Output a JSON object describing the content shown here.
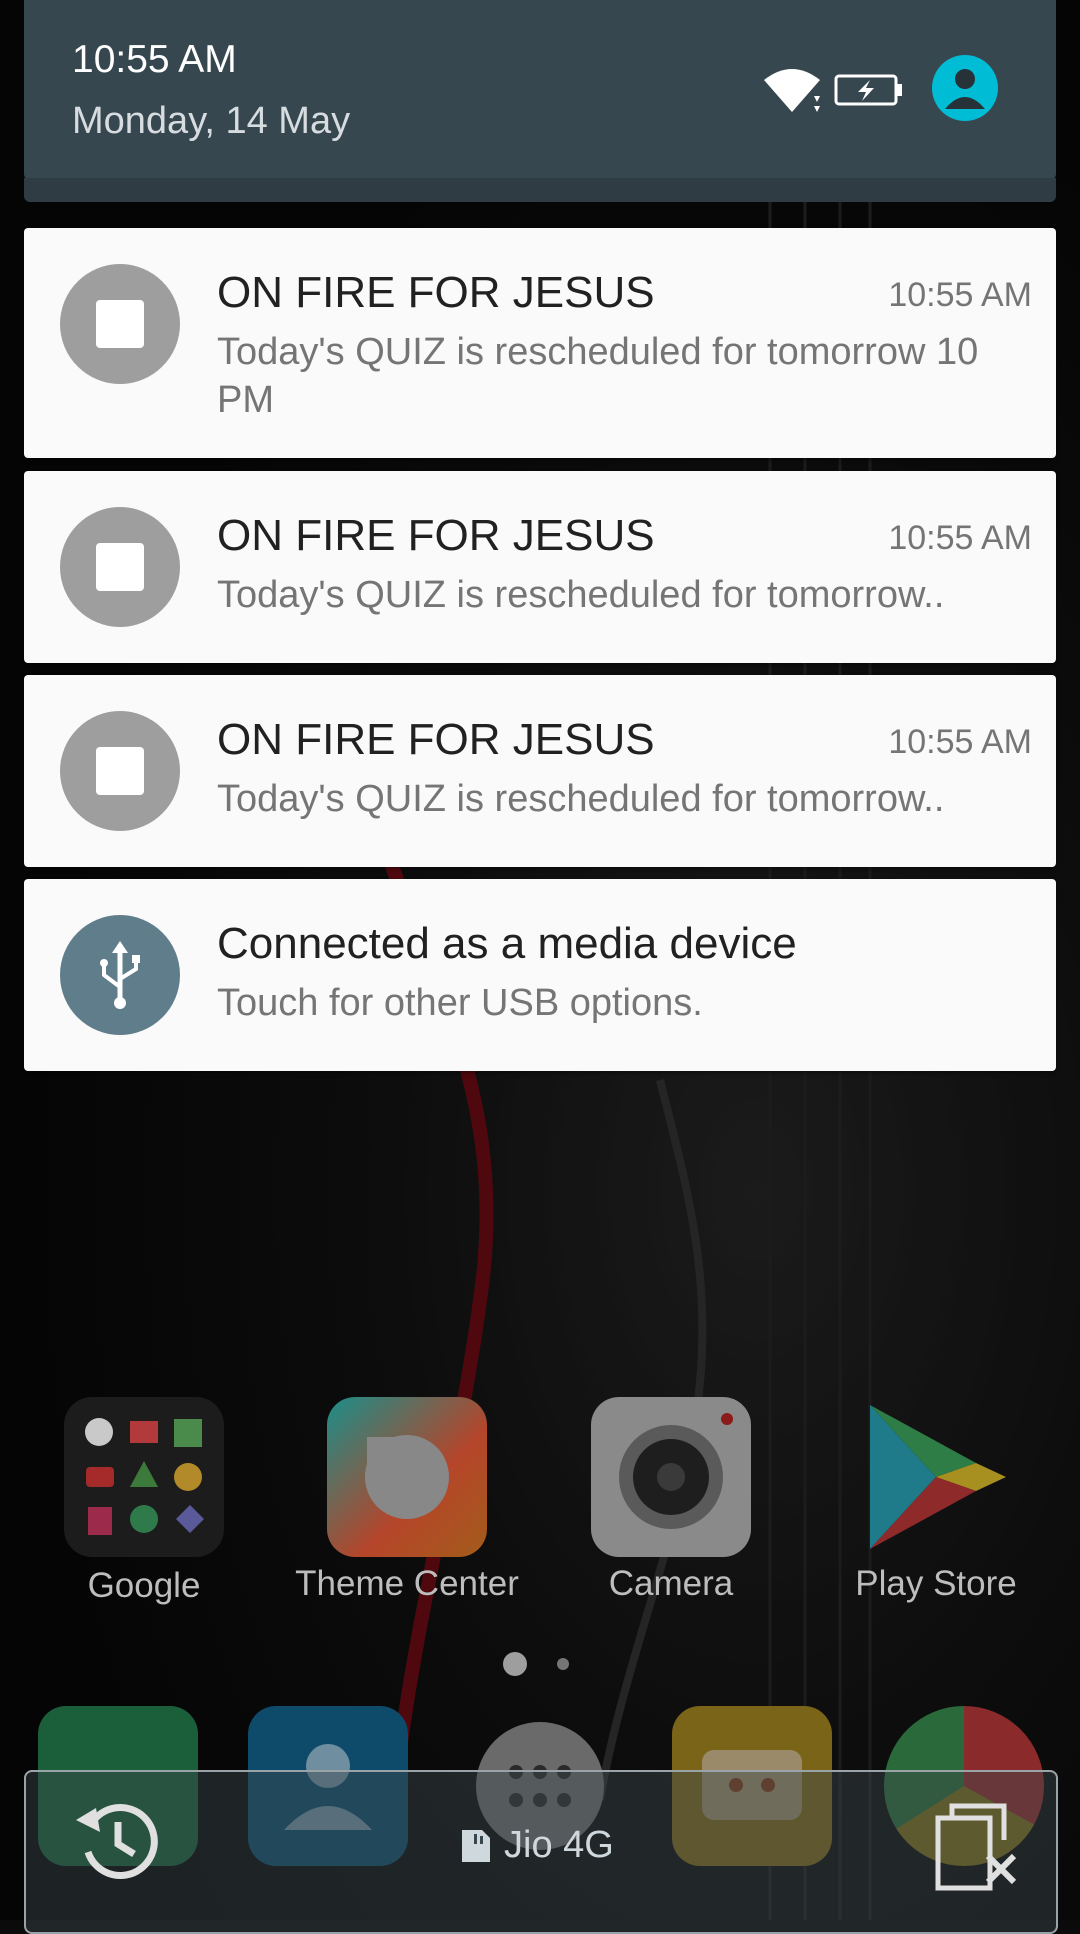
{
  "status": {
    "time": "10:55 AM",
    "date": "Monday, 14 May"
  },
  "notifications": [
    {
      "title": "ON FIRE FOR JESUS",
      "time": "10:55 AM",
      "text": "Today's QUIZ is rescheduled for tomorrow 10 PM"
    },
    {
      "title": "ON FIRE FOR JESUS",
      "time": "10:55 AM",
      "text": "Today's QUIZ is rescheduled for tomorrow.."
    },
    {
      "title": "ON FIRE FOR JESUS",
      "time": "10:55 AM",
      "text": "Today's QUIZ is rescheduled for tomorrow.."
    },
    {
      "title": "Connected as a media device",
      "text": "Touch for other USB options."
    }
  ],
  "home": {
    "apps": [
      {
        "label": "Google"
      },
      {
        "label": "Theme Center"
      },
      {
        "label": "Camera"
      },
      {
        "label": "Play Store"
      }
    ]
  },
  "bottom_bar": {
    "carrier": "Jio 4G"
  },
  "colors": {
    "header": "#37474f",
    "avatar": "#00bcd4",
    "usb_icon": "#607d8b"
  }
}
